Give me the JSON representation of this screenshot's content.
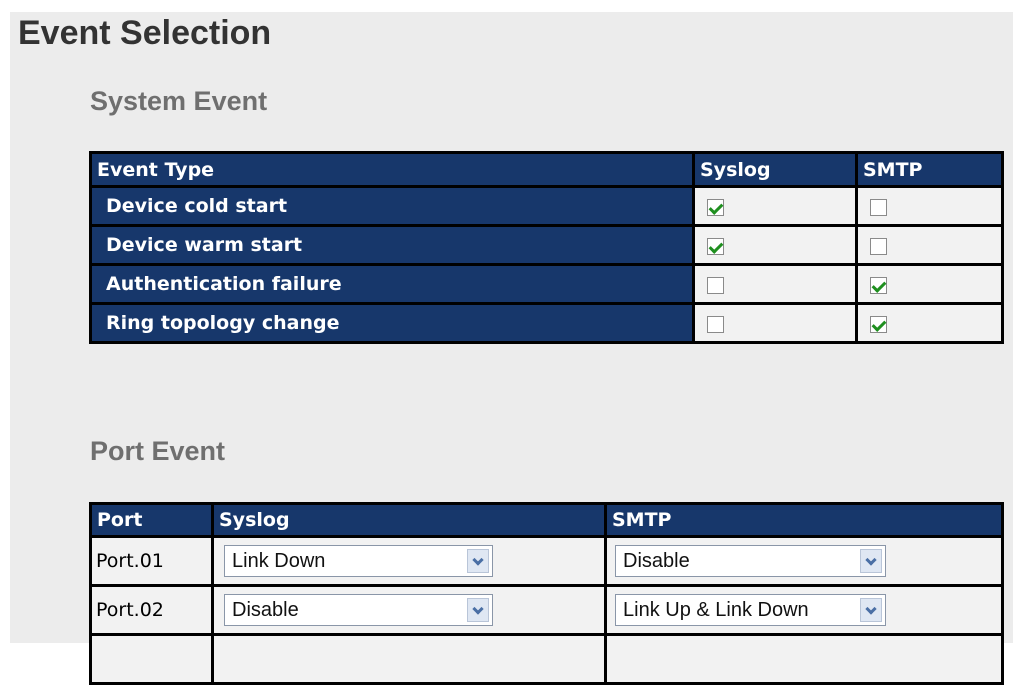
{
  "page": {
    "title": "Event Selection"
  },
  "system_event": {
    "title": "System Event",
    "headers": {
      "event_type": "Event Type",
      "syslog": "Syslog",
      "smtp": "SMTP"
    },
    "rows": [
      {
        "event": "Device cold start",
        "syslog": true,
        "smtp": false
      },
      {
        "event": "Device warm start",
        "syslog": true,
        "smtp": false
      },
      {
        "event": "Authentication failure",
        "syslog": false,
        "smtp": true
      },
      {
        "event": "Ring topology change",
        "syslog": false,
        "smtp": true
      }
    ]
  },
  "port_event": {
    "title": "Port Event",
    "headers": {
      "port": "Port",
      "syslog": "Syslog",
      "smtp": "SMTP"
    },
    "rows": [
      {
        "port": "Port.01",
        "syslog": "Link Down",
        "smtp": "Disable"
      },
      {
        "port": "Port.02",
        "syslog": "Disable",
        "smtp": "Link Up & Link Down"
      }
    ]
  },
  "colors": {
    "header_bg": "#17376b",
    "panel_bg": "#ececec",
    "check_mark": "#1f8f1f"
  },
  "icons": {
    "dropdown": "chevron-down-icon",
    "checkbox_checked": "checkmark-icon"
  }
}
